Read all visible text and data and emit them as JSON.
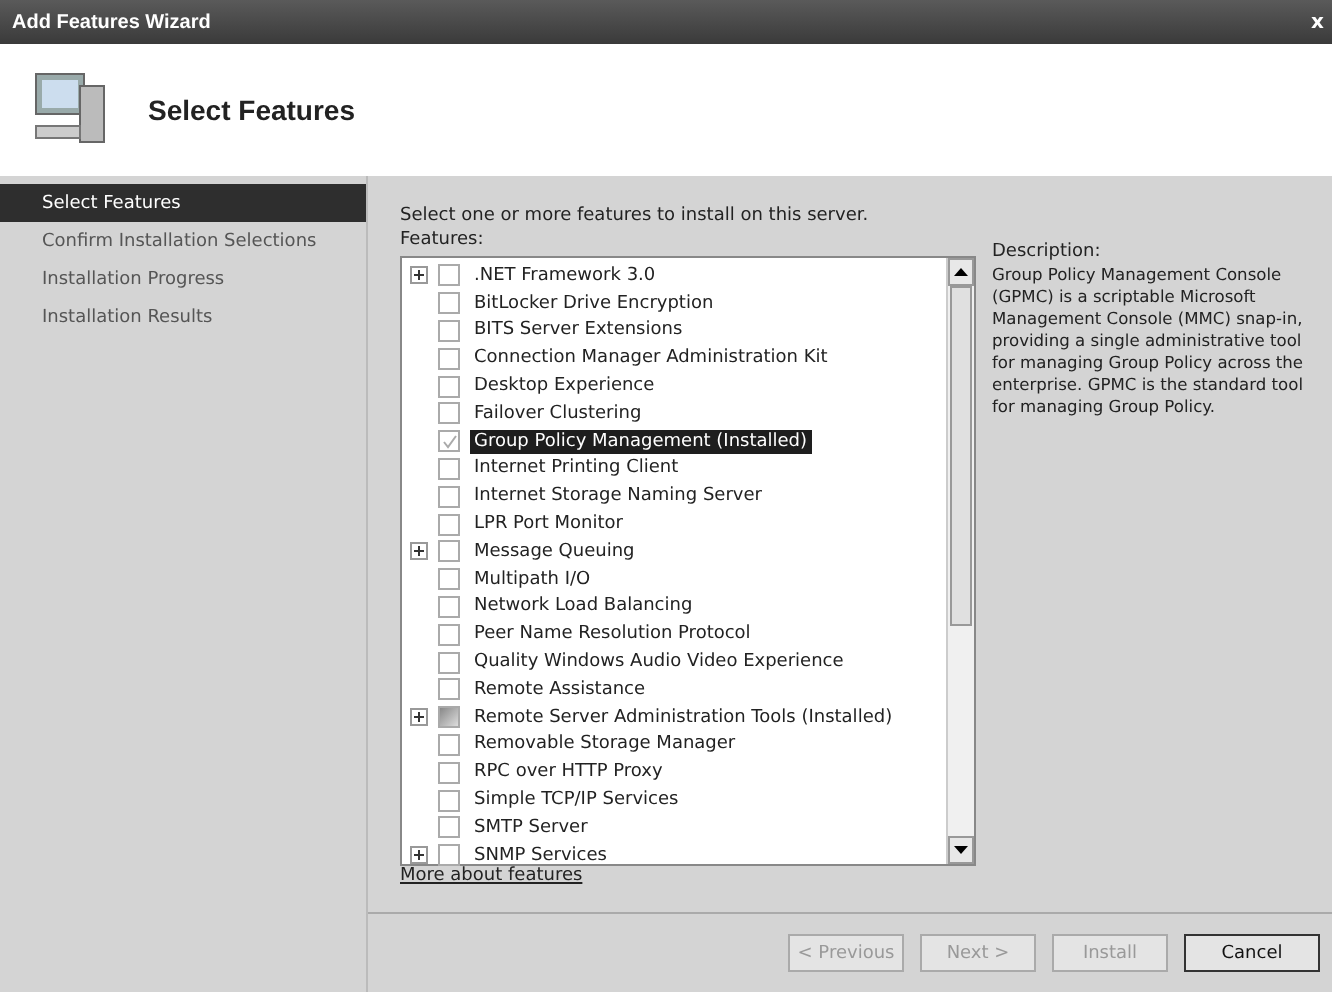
{
  "window": {
    "title": "Add Features Wizard",
    "close": "x"
  },
  "header": {
    "title": "Select Features"
  },
  "sidebar": {
    "items": [
      {
        "label": "Select Features",
        "selected": true
      },
      {
        "label": "Confirm Installation Selections",
        "selected": false
      },
      {
        "label": "Installation Progress",
        "selected": false
      },
      {
        "label": "Installation Results",
        "selected": false
      }
    ]
  },
  "main": {
    "instruction": "Select one or more features to install on this server.",
    "features_label": "Features:",
    "features": [
      {
        "label": ".NET Framework 3.0",
        "expandable": true,
        "checked": false,
        "partial": false,
        "selected": false
      },
      {
        "label": "BitLocker Drive Encryption",
        "expandable": false,
        "checked": false,
        "partial": false,
        "selected": false
      },
      {
        "label": "BITS Server Extensions",
        "expandable": false,
        "checked": false,
        "partial": false,
        "selected": false
      },
      {
        "label": "Connection Manager Administration Kit",
        "expandable": false,
        "checked": false,
        "partial": false,
        "selected": false
      },
      {
        "label": "Desktop Experience",
        "expandable": false,
        "checked": false,
        "partial": false,
        "selected": false
      },
      {
        "label": "Failover Clustering",
        "expandable": false,
        "checked": false,
        "partial": false,
        "selected": false
      },
      {
        "label": "Group Policy Management  (Installed)",
        "expandable": false,
        "checked": true,
        "partial": false,
        "selected": true
      },
      {
        "label": "Internet Printing Client",
        "expandable": false,
        "checked": false,
        "partial": false,
        "selected": false
      },
      {
        "label": "Internet Storage Naming Server",
        "expandable": false,
        "checked": false,
        "partial": false,
        "selected": false
      },
      {
        "label": "LPR Port Monitor",
        "expandable": false,
        "checked": false,
        "partial": false,
        "selected": false
      },
      {
        "label": "Message Queuing",
        "expandable": true,
        "checked": false,
        "partial": false,
        "selected": false
      },
      {
        "label": "Multipath I/O",
        "expandable": false,
        "checked": false,
        "partial": false,
        "selected": false
      },
      {
        "label": "Network Load Balancing",
        "expandable": false,
        "checked": false,
        "partial": false,
        "selected": false
      },
      {
        "label": "Peer Name Resolution Protocol",
        "expandable": false,
        "checked": false,
        "partial": false,
        "selected": false
      },
      {
        "label": "Quality Windows Audio Video Experience",
        "expandable": false,
        "checked": false,
        "partial": false,
        "selected": false
      },
      {
        "label": "Remote Assistance",
        "expandable": false,
        "checked": false,
        "partial": false,
        "selected": false
      },
      {
        "label": "Remote Server Administration Tools  (Installed)",
        "expandable": true,
        "checked": false,
        "partial": true,
        "selected": false
      },
      {
        "label": "Removable Storage Manager",
        "expandable": false,
        "checked": false,
        "partial": false,
        "selected": false
      },
      {
        "label": "RPC over HTTP Proxy",
        "expandable": false,
        "checked": false,
        "partial": false,
        "selected": false
      },
      {
        "label": "Simple TCP/IP Services",
        "expandable": false,
        "checked": false,
        "partial": false,
        "selected": false
      },
      {
        "label": "SMTP Server",
        "expandable": false,
        "checked": false,
        "partial": false,
        "selected": false
      },
      {
        "label": "SNMP Services",
        "expandable": true,
        "checked": false,
        "partial": false,
        "selected": false
      }
    ],
    "link": "More about features",
    "description_label": "Description:",
    "description": "Group Policy Management Console (GPMC) is a scriptable Microsoft Management Console (MMC) snap-in, providing a single administrative tool for managing Group Policy across the enterprise. GPMC is the standard tool for managing Group Policy."
  },
  "buttons": [
    {
      "label": "< Previous",
      "disabled": true
    },
    {
      "label": "Next >",
      "disabled": true
    },
    {
      "label": "Install",
      "disabled": true
    },
    {
      "label": "Cancel",
      "disabled": false
    }
  ]
}
